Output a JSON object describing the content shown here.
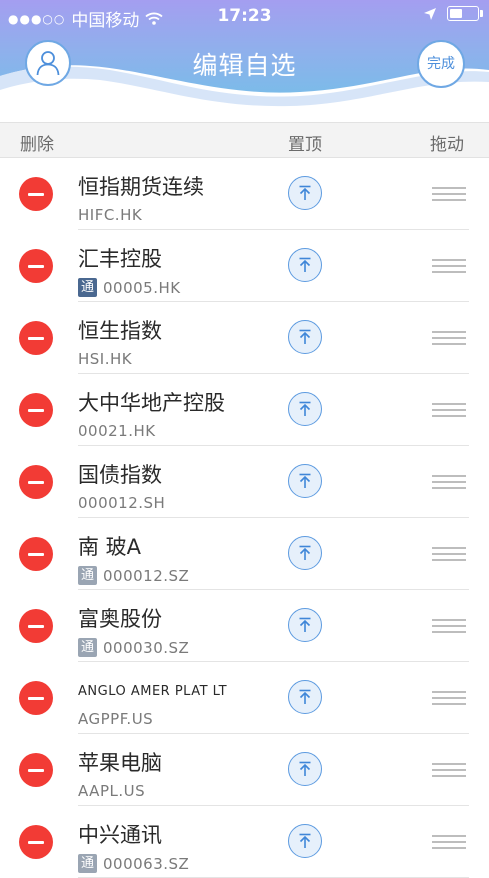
{
  "status_bar": {
    "carrier": "中国移动",
    "time": "17:23"
  },
  "header": {
    "title": "编辑自选",
    "done_label": "完成"
  },
  "columns": {
    "delete": "删除",
    "pin": "置顶",
    "drag": "拖动"
  },
  "colors": {
    "header_top": "#9aa4ee",
    "header_bottom": "#7fb3e8",
    "delete_red": "#f23b35",
    "accent_blue": "#4d8fdb"
  },
  "stocks": [
    {
      "name": "恒指期货连续",
      "code": "HIFC.HK",
      "badge": ""
    },
    {
      "name": "汇丰控股",
      "code": "00005.HK",
      "badge": "通"
    },
    {
      "name": "恒生指数",
      "code": "HSI.HK",
      "badge": ""
    },
    {
      "name": "大中华地产控股",
      "code": "00021.HK",
      "badge": ""
    },
    {
      "name": "国债指数",
      "code": "000012.SH",
      "badge": ""
    },
    {
      "name": "南  玻A",
      "code": "000012.SZ",
      "badge": "通"
    },
    {
      "name": "富奥股份",
      "code": "000030.SZ",
      "badge": "通"
    },
    {
      "name": "ANGLO AMER PLAT LT",
      "code": "AGPPF.US",
      "badge": ""
    },
    {
      "name": "苹果电脑",
      "code": "AAPL.US",
      "badge": ""
    },
    {
      "name": "中兴通讯",
      "code": "000063.SZ",
      "badge": "通"
    }
  ]
}
